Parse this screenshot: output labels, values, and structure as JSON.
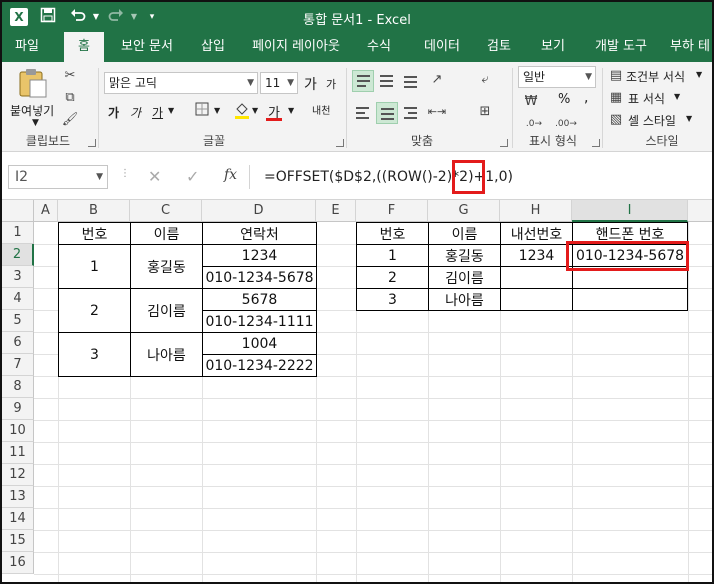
{
  "app": {
    "logo": "X",
    "title": "통합 문서1 - Excel"
  },
  "qat": {
    "save_icon": "save-icon",
    "undo_icon": "undo-icon",
    "redo_icon": "redo-icon",
    "customize_icon": "customize-icon"
  },
  "tabs": [
    {
      "label": "파일"
    },
    {
      "label": "홈"
    },
    {
      "label": "보안 문서"
    },
    {
      "label": "삽입"
    },
    {
      "label": "페이지 레이아웃"
    },
    {
      "label": "수식"
    },
    {
      "label": "데이터"
    },
    {
      "label": "검토"
    },
    {
      "label": "보기"
    },
    {
      "label": "개발 도구"
    },
    {
      "label": "부하 테"
    }
  ],
  "ribbon": {
    "clipboard": {
      "paste_label": "붙여넣기",
      "group_label": "클립보드"
    },
    "font": {
      "font_name": "맑은 고딕",
      "font_size": "11",
      "bold": "가",
      "italic": "가",
      "underline": "가",
      "grow": "가",
      "shrink": "가",
      "phonetic": "내천",
      "fontcolor": "가",
      "group_label": "글꼴"
    },
    "alignment": {
      "group_label": "맞춤"
    },
    "number": {
      "format": "일반",
      "percent": "%",
      "comma": ",",
      "group_label": "표시 형식"
    },
    "styles": {
      "conditional": "조건부 서식",
      "table": "표 서식",
      "cell": "셀 스타일",
      "group_label": "스타일"
    }
  },
  "formula_bar": {
    "name_box": "I2",
    "cancel": "✕",
    "enter": "✓",
    "fx": "fx",
    "formula": "=OFFSET($D$2,((ROW()-2)*2)+1,0)"
  },
  "grid": {
    "columns": [
      "A",
      "B",
      "C",
      "D",
      "E",
      "F",
      "G",
      "H",
      "I"
    ],
    "rows": [
      "1",
      "2",
      "3",
      "4",
      "5",
      "6",
      "7",
      "8",
      "9",
      "10",
      "11",
      "12",
      "13",
      "14",
      "15",
      "16"
    ],
    "selected_cell": "I2"
  },
  "table_left": {
    "headers": [
      "번호",
      "이름",
      "연락처"
    ],
    "groups": [
      {
        "num": "1",
        "name": "홍길동",
        "contacts": [
          "1234",
          "010-1234-5678"
        ]
      },
      {
        "num": "2",
        "name": "김이름",
        "contacts": [
          "5678",
          "010-1234-1111"
        ]
      },
      {
        "num": "3",
        "name": "나아름",
        "contacts": [
          "1004",
          "010-1234-2222"
        ]
      }
    ]
  },
  "table_right": {
    "headers": [
      "번호",
      "이름",
      "내선번호",
      "핸드폰 번호"
    ],
    "rows": [
      [
        "1",
        "홍길동",
        "1234",
        "010-1234-5678"
      ],
      [
        "2",
        "김이름",
        "",
        ""
      ],
      [
        "3",
        "나아름",
        "",
        ""
      ]
    ]
  },
  "colors": {
    "accent": "#217346",
    "highlight": "#e31b1b"
  }
}
